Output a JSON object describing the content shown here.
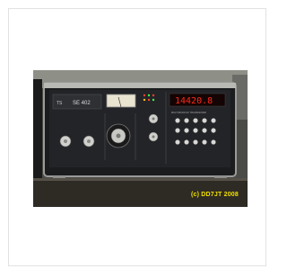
{
  "photo": {
    "copyright": "(c) DD7JT 2008",
    "brand_label": "SE 402",
    "frequency_display": "14420.8",
    "panel_text": "MULTI-BAND HF TRANSCEIVER"
  },
  "colors": {
    "card_border": "#e2e2e2",
    "caption": "#f2e200",
    "frequency_led": "#ff2a1a"
  }
}
